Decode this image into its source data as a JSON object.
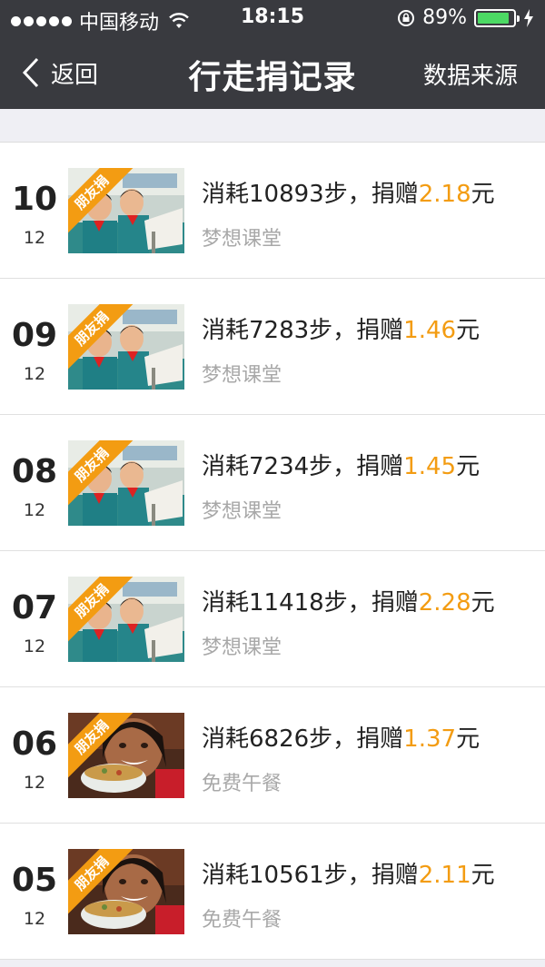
{
  "status": {
    "carrier": "中国移动",
    "time": "18:15",
    "battery": "89%",
    "battery_level": 0.89
  },
  "nav": {
    "back_label": "返回",
    "title": "行走捐记录",
    "source_label": "数据来源"
  },
  "ribbon_label": "朋友捐",
  "records": [
    {
      "day": "10",
      "month": "12",
      "prefix": "消耗10893步，捐赠",
      "amount": "2.18",
      "suffix": "元",
      "project": "梦想课堂",
      "image": "classroom"
    },
    {
      "day": "09",
      "month": "12",
      "prefix": "消耗7283步，捐赠",
      "amount": "1.46",
      "suffix": "元",
      "project": "梦想课堂",
      "image": "classroom"
    },
    {
      "day": "08",
      "month": "12",
      "prefix": "消耗7234步，捐赠",
      "amount": "1.45",
      "suffix": "元",
      "project": "梦想课堂",
      "image": "classroom"
    },
    {
      "day": "07",
      "month": "12",
      "prefix": "消耗11418步，捐赠",
      "amount": "2.28",
      "suffix": "元",
      "project": "梦想课堂",
      "image": "classroom"
    },
    {
      "day": "06",
      "month": "12",
      "prefix": "消耗6826步，捐赠",
      "amount": "1.37",
      "suffix": "元",
      "project": "免费午餐",
      "image": "lunch"
    },
    {
      "day": "05",
      "month": "12",
      "prefix": "消耗10561步，捐赠",
      "amount": "2.11",
      "suffix": "元",
      "project": "免费午餐",
      "image": "lunch"
    }
  ],
  "colors": {
    "bar": "#393a3f",
    "amount": "#f39c12",
    "battery": "#4cd964"
  }
}
